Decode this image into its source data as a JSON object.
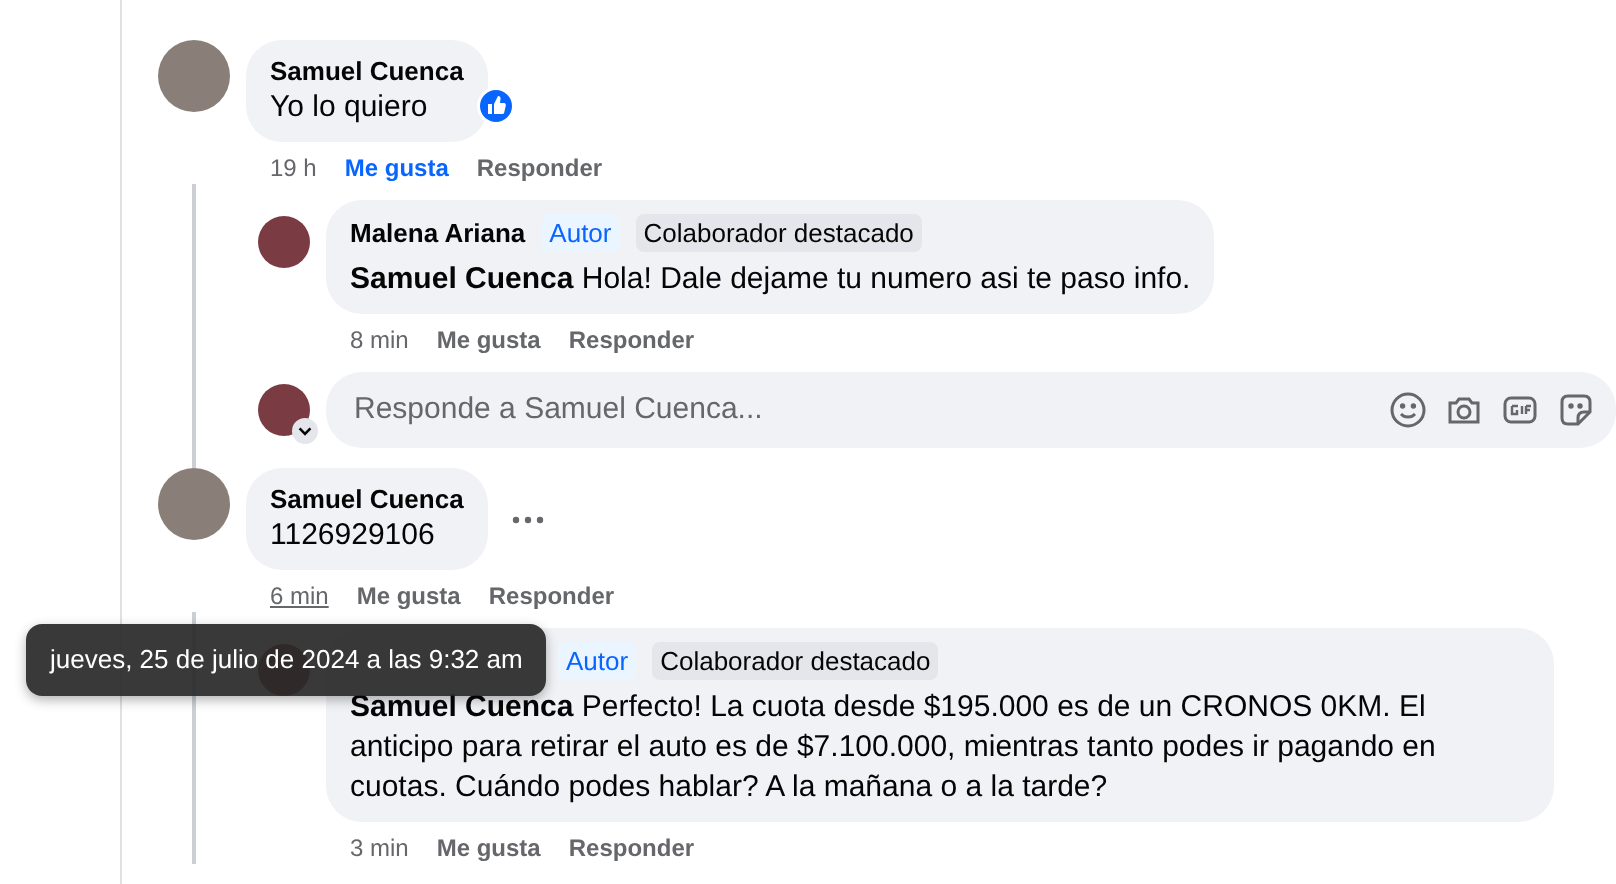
{
  "comments": [
    {
      "author": "Samuel Cuenca",
      "text": "Yo lo quiero",
      "reacted": true,
      "more_menu": false,
      "time": "19 h",
      "time_hovered": false,
      "actions": [
        {
          "label": "Me gusta",
          "selected": true
        },
        {
          "label": "Responder",
          "selected": false
        }
      ],
      "replies": [
        {
          "author": "Malena Ariana",
          "badges": [
            {
              "kind": "role",
              "label": "Autor"
            },
            {
              "kind": "tag",
              "label": "Colaborador destacado"
            }
          ],
          "mention": "Samuel Cuenca",
          "text": "Hola! Dale dejame tu numero asi te paso info.",
          "time": "8 min",
          "actions": [
            {
              "label": "Me gusta",
              "selected": false
            },
            {
              "label": "Responder",
              "selected": false
            }
          ]
        }
      ],
      "reply_box": {
        "placeholder": "Responde a Samuel Cuenca..."
      }
    },
    {
      "author": "Samuel Cuenca",
      "text": "1126929106",
      "reacted": false,
      "more_menu": true,
      "time": "6 min",
      "time_hovered": true,
      "actions": [
        {
          "label": "Me gusta",
          "selected": false
        },
        {
          "label": "Responder",
          "selected": false
        }
      ],
      "replies": [
        {
          "badges": [
            {
              "kind": "role",
              "label": "Autor"
            },
            {
              "kind": "tag",
              "label": "Colaborador destacado"
            }
          ],
          "mention": "Samuel Cuenca",
          "text": "Perfecto! La cuota desde $195.000 es de un CRONOS 0KM. El anticipo para retirar el auto es de $7.100.000, mientras tanto podes ir pagando en cuotas. Cuándo podes hablar? A la mañana o a la tarde?",
          "time": "3 min",
          "actions": [
            {
              "label": "Me gusta",
              "selected": false
            },
            {
              "label": "Responder",
              "selected": false
            }
          ]
        }
      ]
    }
  ],
  "tooltip": {
    "text": "jueves, 25 de julio de 2024 a las 9:32 am"
  }
}
